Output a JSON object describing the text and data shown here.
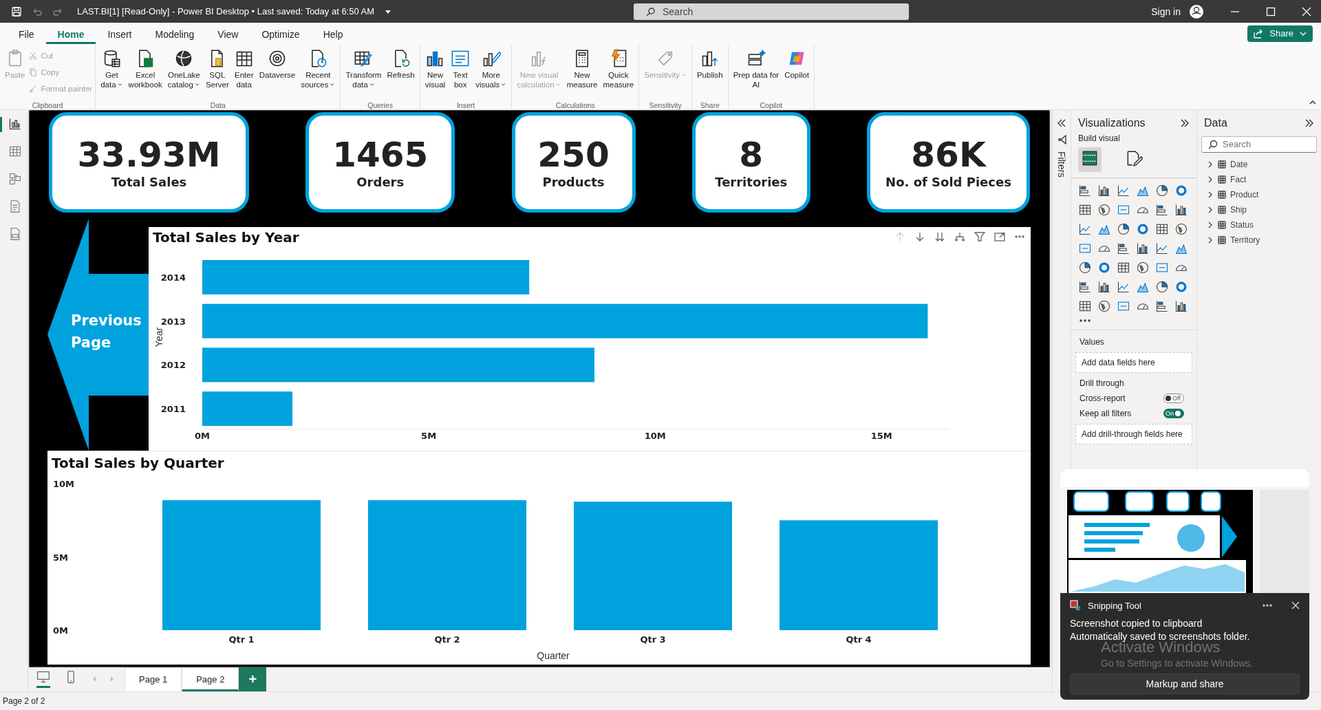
{
  "title_bar": {
    "title": "LAST.BI[1] [Read-Only] - Power BI Desktop • Last saved: Today at 6:50 AM",
    "search": {
      "placeholder": "Search"
    },
    "sign_in": "Sign in"
  },
  "menu_tabs": [
    {
      "label": "File",
      "selected": false
    },
    {
      "label": "Home",
      "selected": true
    },
    {
      "label": "Insert",
      "selected": false
    },
    {
      "label": "Modeling",
      "selected": false
    },
    {
      "label": "View",
      "selected": false
    },
    {
      "label": "Optimize",
      "selected": false
    },
    {
      "label": "Help",
      "selected": false
    }
  ],
  "share_button": "Share",
  "ribbon": [
    {
      "name": "Clipboard",
      "items": [
        {
          "label": "Paste",
          "kind": "large",
          "disabled": true,
          "dropdown": false
        },
        {
          "label": "Cut",
          "kind": "small",
          "disabled": true
        },
        {
          "label": "Copy",
          "kind": "small",
          "disabled": true
        },
        {
          "label": "Format painter",
          "kind": "small",
          "disabled": true
        }
      ]
    },
    {
      "name": "Data",
      "items": [
        {
          "label": "Get\ndata",
          "kind": "large",
          "disabled": false,
          "dropdown": true
        },
        {
          "label": "Excel\nworkbook",
          "kind": "large",
          "disabled": false,
          "dropdown": false
        },
        {
          "label": "OneLake\ncatalog",
          "kind": "large",
          "disabled": false,
          "dropdown": true
        },
        {
          "label": "SQL\nServer",
          "kind": "large",
          "disabled": false,
          "dropdown": false
        },
        {
          "label": "Enter\ndata",
          "kind": "large",
          "disabled": false,
          "dropdown": false
        },
        {
          "label": "Dataverse",
          "kind": "large",
          "disabled": false,
          "dropdown": false
        },
        {
          "label": "Recent\nsources",
          "kind": "large",
          "disabled": false,
          "dropdown": true
        }
      ]
    },
    {
      "name": "Queries",
      "items": [
        {
          "label": "Transform\ndata",
          "kind": "large",
          "disabled": false,
          "dropdown": true
        },
        {
          "label": "Refresh",
          "kind": "large",
          "disabled": false,
          "dropdown": false
        }
      ]
    },
    {
      "name": "Insert",
      "items": [
        {
          "label": "New\nvisual",
          "kind": "large",
          "disabled": false,
          "dropdown": false
        },
        {
          "label": "Text\nbox",
          "kind": "large",
          "disabled": false,
          "dropdown": false
        },
        {
          "label": "More\nvisuals",
          "kind": "large",
          "disabled": false,
          "dropdown": true
        }
      ]
    },
    {
      "name": "Calculations",
      "items": [
        {
          "label": "New visual\ncalculation",
          "kind": "large",
          "disabled": true,
          "dropdown": true
        },
        {
          "label": "New\nmeasure",
          "kind": "large",
          "disabled": false,
          "dropdown": false
        },
        {
          "label": "Quick\nmeasure",
          "kind": "large",
          "disabled": false,
          "dropdown": false
        }
      ]
    },
    {
      "name": "Sensitivity",
      "items": [
        {
          "label": "Sensitivity",
          "kind": "large",
          "disabled": true,
          "dropdown": true
        }
      ]
    },
    {
      "name": "Share",
      "items": [
        {
          "label": "Publish",
          "kind": "large",
          "disabled": false,
          "dropdown": false
        }
      ]
    },
    {
      "name": "Copilot",
      "items": [
        {
          "label": "Prep data for\nAI",
          "kind": "large",
          "disabled": false,
          "dropdown": false
        },
        {
          "label": "Copilot",
          "kind": "large",
          "disabled": false,
          "dropdown": false
        }
      ]
    }
  ],
  "left_rail": [
    {
      "kind": "report",
      "selected": true
    },
    {
      "kind": "table",
      "selected": false
    },
    {
      "kind": "model",
      "selected": false
    },
    {
      "kind": "dax",
      "selected": false
    },
    {
      "kind": "tmdl",
      "selected": false
    }
  ],
  "report": {
    "kpis": [
      {
        "value": "33.93M",
        "label": "Total Sales"
      },
      {
        "value": "1465",
        "label": "Orders"
      },
      {
        "value": "250",
        "label": "Products"
      },
      {
        "value": "8",
        "label": "Territories"
      },
      {
        "value": "86K",
        "label": "No. of Sold Pieces"
      }
    ],
    "nav_button": "Previous Page",
    "year_chart": {
      "chart_data": {
        "type": "bar",
        "orientation": "horizontal",
        "title": "Total Sales by Year",
        "ylabel": "Year",
        "categories": [
          "2014",
          "2013",
          "2012",
          "2011"
        ],
        "series": [
          {
            "color": "#00a2de",
            "values": [
              7.22,
              16.02,
              8.66,
              1.99
            ]
          }
        ],
        "xlim": [
          0,
          16.5
        ],
        "xticks": [
          {
            "value": 0,
            "label": "0M"
          },
          {
            "value": 5,
            "label": "5M"
          },
          {
            "value": 10,
            "label": "10M"
          },
          {
            "value": 15,
            "label": "15M"
          }
        ]
      }
    },
    "quarter_chart": {
      "chart_data": {
        "type": "bar",
        "orientation": "vertical",
        "title": "Total Sales by Quarter",
        "xlabel": "Quarter",
        "categories": [
          "Qtr 1",
          "Qtr 2",
          "Qtr 3",
          "Qtr 4"
        ],
        "series": [
          {
            "color": "#00a2de",
            "values": [
              8.87,
              8.87,
              8.77,
              7.5
            ]
          }
        ],
        "ylim": [
          0,
          10
        ],
        "yticks": [
          {
            "value": 0,
            "label": "0M"
          },
          {
            "value": 5,
            "label": "5M"
          },
          {
            "value": 10,
            "label": "10M"
          }
        ]
      }
    }
  },
  "page_bar": {
    "views": [
      {
        "kind": "desktop",
        "selected": true
      },
      {
        "kind": "phone",
        "selected": false
      }
    ],
    "pages": [
      {
        "label": "Page 1",
        "selected": false
      },
      {
        "label": "Page 2",
        "selected": true
      }
    ],
    "add_label": "+"
  },
  "filters": {
    "label": "Filters"
  },
  "visualizations": {
    "title": "Visualizations",
    "subtitle": "Build visual",
    "build_tabs": [
      {
        "kind": "build",
        "selected": true
      },
      {
        "kind": "format",
        "selected": false
      }
    ],
    "values_label": "Values",
    "values_hint": "Add data fields here",
    "drill_title": "Drill through",
    "toggles": [
      {
        "label": "Cross-report",
        "state_text": "Off",
        "on": false
      },
      {
        "label": "Keep all filters",
        "state_text": "On",
        "on": true
      }
    ],
    "drill_hint": "Add drill-through fields here"
  },
  "data_pane": {
    "title": "Data",
    "search": {
      "placeholder": "Search"
    },
    "tables": [
      {
        "name": "Date",
        "expanded": false
      },
      {
        "name": "Fact",
        "expanded": false
      },
      {
        "name": "Product",
        "expanded": false
      },
      {
        "name": "Ship",
        "expanded": false
      },
      {
        "name": "Status",
        "expanded": false
      },
      {
        "name": "Territory",
        "expanded": false
      }
    ]
  },
  "status_bar": {
    "text": "Page 2 of 2"
  },
  "notification": {
    "app": "Snipping Tool",
    "title": "Screenshot copied to clipboard",
    "body": "Automatically saved to screenshots folder.",
    "action": "Markup and share"
  },
  "os_overlay": {
    "title": "Activate Windows",
    "body": "Go to Settings to activate Windows."
  }
}
